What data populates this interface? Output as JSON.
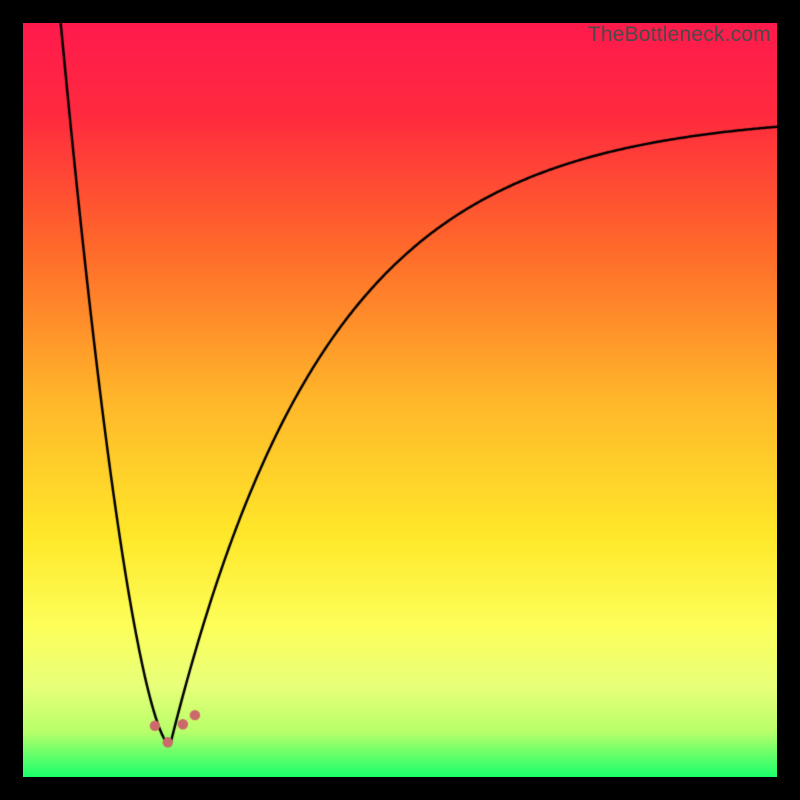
{
  "watermark": "TheBottleneck.com",
  "chart_data": {
    "type": "line",
    "title": "",
    "xlabel": "",
    "ylabel": "",
    "xlim": [
      0,
      100
    ],
    "ylim": [
      0,
      100
    ],
    "gradient_stops": [
      {
        "offset": 0.0,
        "color": "#ff1a4d"
      },
      {
        "offset": 0.12,
        "color": "#ff2a3f"
      },
      {
        "offset": 0.3,
        "color": "#ff6a2a"
      },
      {
        "offset": 0.5,
        "color": "#ffb72a"
      },
      {
        "offset": 0.68,
        "color": "#ffe82a"
      },
      {
        "offset": 0.8,
        "color": "#fdff5a"
      },
      {
        "offset": 0.88,
        "color": "#e8ff7a"
      },
      {
        "offset": 0.94,
        "color": "#b8ff6a"
      },
      {
        "offset": 0.975,
        "color": "#5aff6a"
      },
      {
        "offset": 1.0,
        "color": "#1aff6a"
      }
    ],
    "series": [
      {
        "name": "bottleneck-curve",
        "optimum_x": 19.5,
        "left_branch": {
          "x_start": 5,
          "x_end": 19.5,
          "y_top": 100
        },
        "right_branch": {
          "x_start": 19.5,
          "x_end": 100,
          "asymptote_y": 88
        },
        "dip_y": 4.2
      }
    ],
    "markers": [
      {
        "name": "dip-point-left",
        "x": 17.5,
        "y": 6.8,
        "r": 5.2,
        "color": "#cc6a6a"
      },
      {
        "name": "dip-point-center",
        "x": 19.2,
        "y": 4.6,
        "r": 5.2,
        "color": "#cc6a6a"
      },
      {
        "name": "dip-point-right",
        "x": 21.2,
        "y": 7.0,
        "r": 5.2,
        "color": "#cc6a6a"
      },
      {
        "name": "dip-point-far",
        "x": 22.8,
        "y": 8.2,
        "r": 5.2,
        "color": "#cc6a6a"
      }
    ]
  }
}
